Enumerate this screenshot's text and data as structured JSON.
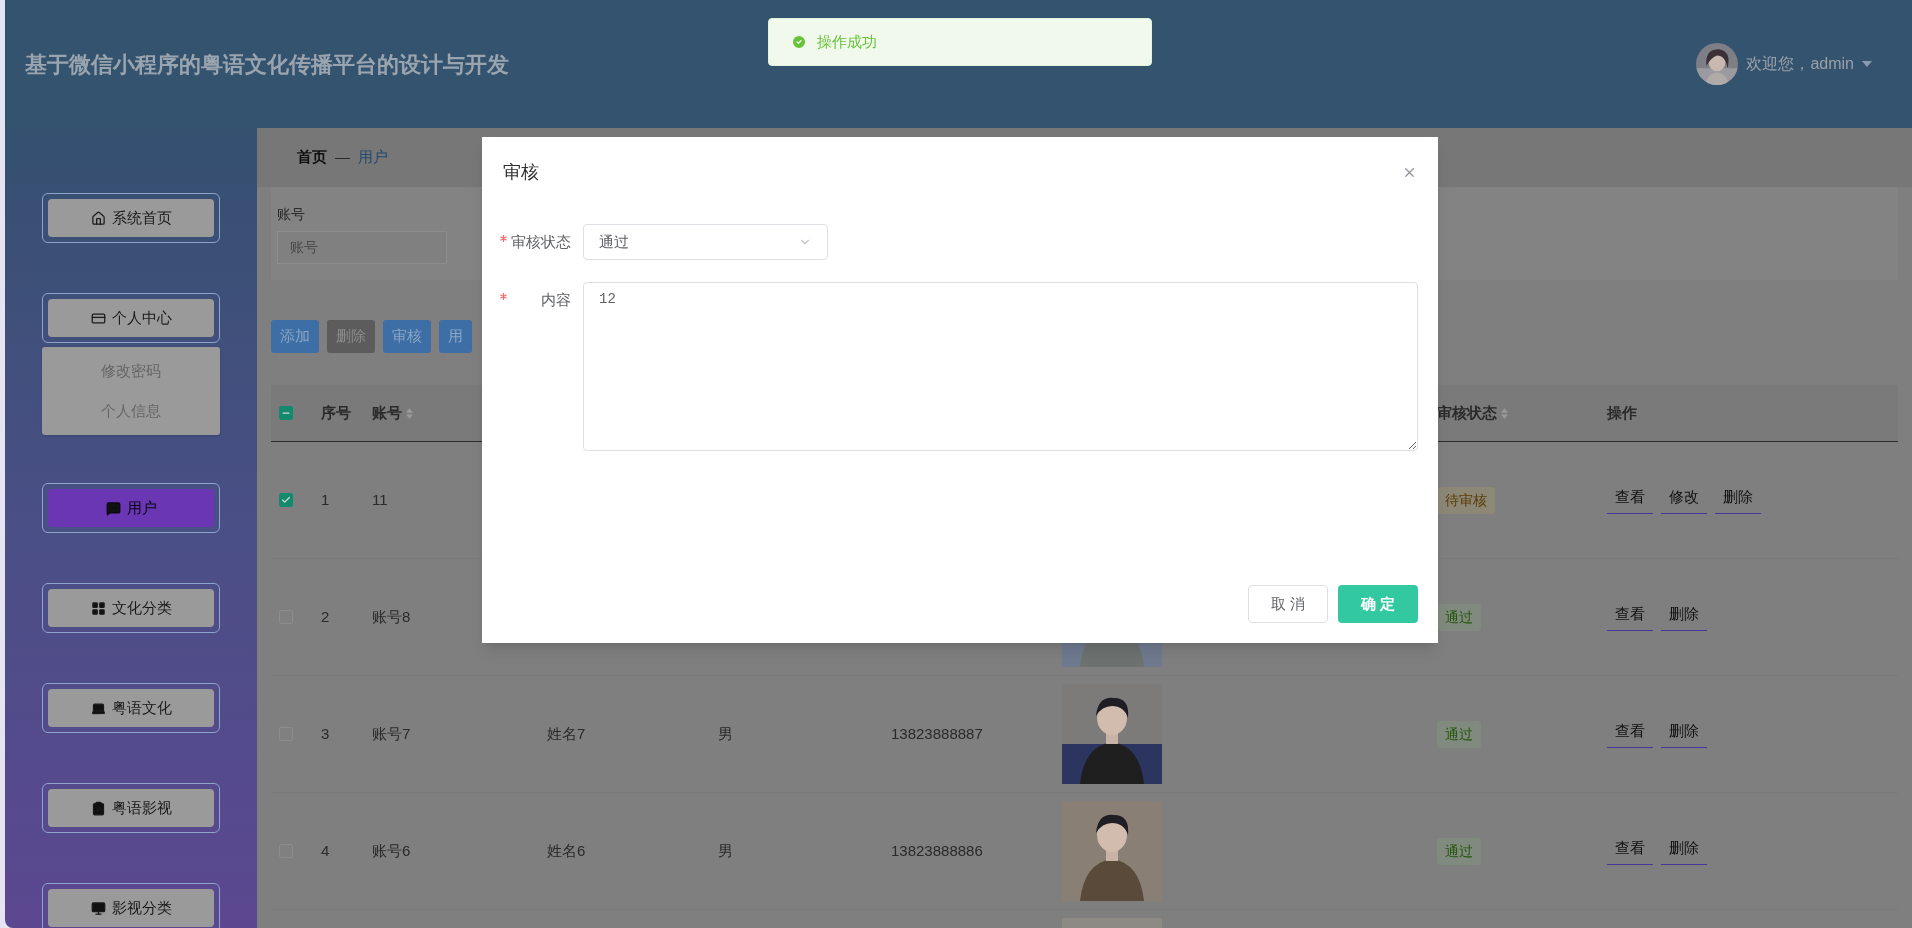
{
  "header": {
    "title": "基于微信小程序的粤语文化传播平台的设计与开发",
    "user": {
      "greeting": "欢迎您，admin"
    }
  },
  "toast": {
    "message": "操作成功"
  },
  "sidebar": {
    "items": [
      {
        "label": "系统首页",
        "selected": false
      },
      {
        "label": "个人中心",
        "selected": false,
        "expanded": true,
        "children": [
          {
            "label": "修改密码"
          },
          {
            "label": "个人信息"
          }
        ]
      },
      {
        "label": "用户",
        "selected": true
      },
      {
        "label": "文化分类",
        "selected": false
      },
      {
        "label": "粤语文化",
        "selected": false
      },
      {
        "label": "粤语影视",
        "selected": false
      },
      {
        "label": "影视分类",
        "selected": false
      }
    ]
  },
  "breadcrumb": {
    "items": [
      "首页",
      "用户"
    ],
    "separator": "—"
  },
  "search": {
    "label": "账号",
    "placeholder": "账号"
  },
  "actions": [
    {
      "label": "添加",
      "kind": "primary"
    },
    {
      "label": "删除",
      "kind": "muted"
    },
    {
      "label": "审核",
      "kind": "primary"
    },
    {
      "label": "用",
      "kind": "primary"
    }
  ],
  "table": {
    "select_all": {
      "indeterminate": true
    },
    "columns": [
      {
        "label": "序号",
        "sortable": false
      },
      {
        "label": "账号",
        "sortable": true
      },
      {
        "label": "审核状态",
        "sortable": true
      },
      {
        "label": "操作",
        "sortable": false
      }
    ],
    "rows": [
      {
        "checked": true,
        "index": "1",
        "account": "11",
        "status": {
          "label": "待审核",
          "kind": "pending"
        },
        "operations": [
          "查看",
          "修改",
          "删除"
        ]
      },
      {
        "checked": false,
        "index": "2",
        "account": "账号8",
        "avatar": {
          "kind": "picture"
        },
        "status": {
          "label": "通过",
          "kind": "approved"
        },
        "operations": [
          "查看",
          "删除"
        ]
      },
      {
        "checked": false,
        "index": "3",
        "account": "账号7",
        "name": "姓名7",
        "gender": "男",
        "phone": "13823888887",
        "avatar": {
          "kind": "picture"
        },
        "status": {
          "label": "通过",
          "kind": "approved"
        },
        "operations": [
          "查看",
          "删除"
        ]
      },
      {
        "checked": false,
        "index": "4",
        "account": "账号6",
        "name": "姓名6",
        "gender": "男",
        "phone": "13823888886",
        "avatar": {
          "kind": "picture"
        },
        "status": {
          "label": "通过",
          "kind": "approved"
        },
        "operations": [
          "查看",
          "删除"
        ]
      },
      {
        "avatar": {
          "kind": "picture"
        }
      }
    ]
  },
  "dialog": {
    "title": "审核",
    "fields": [
      {
        "kind": "select",
        "label": "审核状态",
        "required": true,
        "value": "通过"
      },
      {
        "kind": "textarea",
        "label": "内容",
        "required": true,
        "value": "12"
      }
    ],
    "buttons": [
      {
        "label": "取 消",
        "kind": "secondary"
      },
      {
        "label": "确 定",
        "kind": "primary"
      }
    ]
  }
}
